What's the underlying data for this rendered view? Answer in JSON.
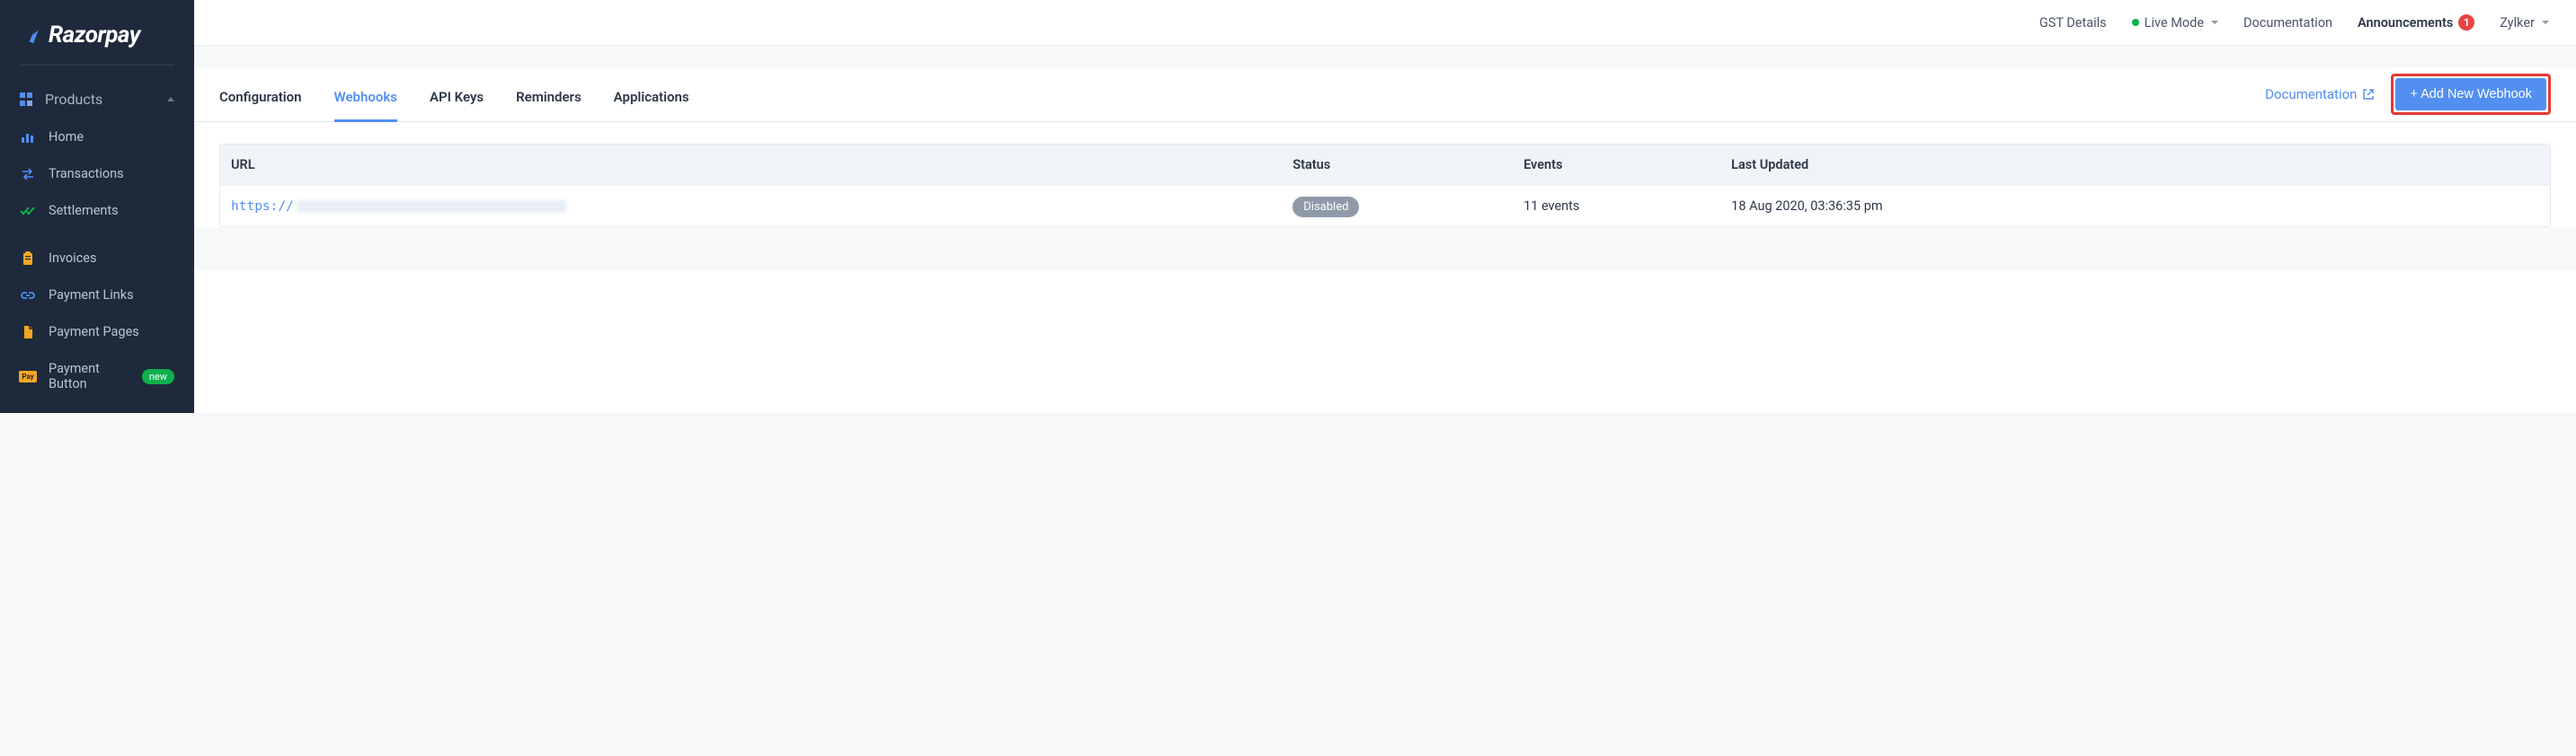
{
  "brand": {
    "name": "Razorpay"
  },
  "sidebar": {
    "section_label": "Products",
    "items": [
      {
        "label": "Home",
        "icon": "bar-chart-icon"
      },
      {
        "label": "Transactions",
        "icon": "exchange-icon"
      },
      {
        "label": "Settlements",
        "icon": "check-double-icon"
      },
      {
        "label": "Invoices",
        "icon": "clipboard-icon"
      },
      {
        "label": "Payment Links",
        "icon": "link-icon"
      },
      {
        "label": "Payment Pages",
        "icon": "page-icon"
      },
      {
        "label": "Payment Button",
        "icon": "pay-badge-icon",
        "badge": "new"
      }
    ]
  },
  "topbar": {
    "gst": "GST Details",
    "mode": "Live Mode",
    "documentation": "Documentation",
    "announcements": "Announcements",
    "announcement_count": "1",
    "account": "Zylker"
  },
  "tabs": {
    "items": [
      {
        "label": "Configuration"
      },
      {
        "label": "Webhooks",
        "active": true
      },
      {
        "label": "API Keys"
      },
      {
        "label": "Reminders"
      },
      {
        "label": "Applications"
      }
    ],
    "doc_link_label": "Documentation",
    "add_button_label": "+ Add New Webhook"
  },
  "table": {
    "headers": {
      "url": "URL",
      "status": "Status",
      "events": "Events",
      "last_updated": "Last Updated"
    },
    "rows": [
      {
        "url_scheme": "https://",
        "status": "Disabled",
        "events": "11 events",
        "last_updated": "18 Aug 2020, 03:36:35 pm"
      }
    ]
  }
}
